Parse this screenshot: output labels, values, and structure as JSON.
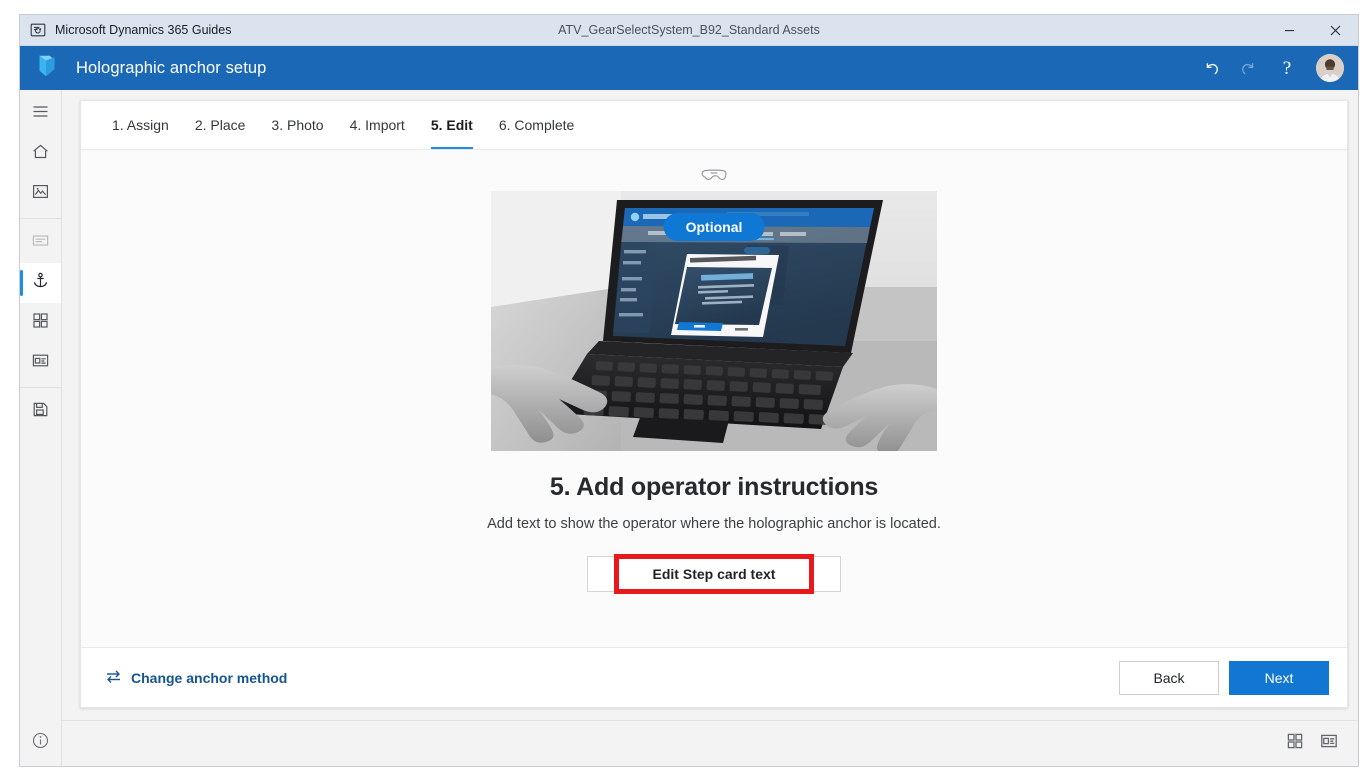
{
  "window": {
    "app_title": "Microsoft Dynamics 365 Guides",
    "document_title": "ATV_GearSelectSystem_B92_Standard Assets",
    "app_icon": "dynamics-guides-icon",
    "controls": [
      {
        "name": "minimize",
        "glyph": "–"
      },
      {
        "name": "close",
        "glyph": "✕"
      }
    ]
  },
  "header": {
    "title": "Holographic anchor setup",
    "logo_icon": "guides-logo",
    "accent_color": "#1b69b6",
    "actions": [
      {
        "name": "undo-button",
        "icon": "undo-icon",
        "enabled": true
      },
      {
        "name": "redo-button",
        "icon": "redo-icon",
        "enabled": false
      },
      {
        "name": "help-button",
        "icon": "help-icon",
        "glyph": "?",
        "enabled": true
      }
    ],
    "avatar": "user-avatar"
  },
  "sidebar": {
    "items": [
      {
        "name": "menu-toggle",
        "icon": "hamburger-icon",
        "state": "normal"
      },
      {
        "name": "home",
        "icon": "home-icon",
        "state": "normal"
      },
      {
        "name": "media",
        "icon": "image-icon",
        "state": "normal"
      },
      {
        "name": "text-steps",
        "icon": "text-lines-icon",
        "state": "disabled"
      },
      {
        "name": "anchor",
        "icon": "anchor-icon",
        "state": "selected"
      },
      {
        "name": "assets",
        "icon": "grid-tiles-icon",
        "state": "normal"
      },
      {
        "name": "step-card",
        "icon": "card-panel-icon",
        "state": "normal"
      },
      {
        "name": "save",
        "icon": "save-disk-icon",
        "state": "normal"
      }
    ],
    "bottom_item": {
      "name": "info",
      "icon": "info-icon"
    }
  },
  "tabs": [
    {
      "label": "1. Assign",
      "active": false
    },
    {
      "label": "2. Place",
      "active": false
    },
    {
      "label": "3. Photo",
      "active": false
    },
    {
      "label": "4. Import",
      "active": false
    },
    {
      "label": "5. Edit",
      "active": true
    },
    {
      "label": "6. Complete",
      "active": false
    }
  ],
  "main": {
    "headset_icon": "hololens-headset-icon",
    "badge_label": "Optional",
    "badge_color": "#0f78d4",
    "photo": {
      "name": "laptop-hands-typing-photo",
      "description": "Grayscale photo of two hands typing on a laptop that displays the Edit anchoring instructions dialog",
      "laptop_screen": {
        "app_header": "Holographic anchor setup",
        "dialog_title": "Edit anchoring instructions",
        "card_title": "Align Digital Anchor",
        "card_lines": [
          "1. Align 'digital anchor' hologram to co-real world object.",
          "2. Tap and hold the hologram to move.",
          "3. Tap and hold the step."
        ],
        "primary_button": "Done",
        "secondary_button": "Cancel"
      }
    },
    "title": "5. Add operator instructions",
    "subtitle": "Add text to show the operator where the holographic anchor is located.",
    "edit_button_label": "Edit Step card text",
    "highlight_color": "#e8191c"
  },
  "footer": {
    "change_method_label": "Change anchor method",
    "change_method_icon": "swap-arrows-icon",
    "back_label": "Back",
    "next_label": "Next"
  },
  "statusbar": {
    "buttons": [
      {
        "name": "grid-view-toggle",
        "icon": "grid-view-icon"
      },
      {
        "name": "detail-view-toggle",
        "icon": "detail-view-icon"
      }
    ]
  }
}
